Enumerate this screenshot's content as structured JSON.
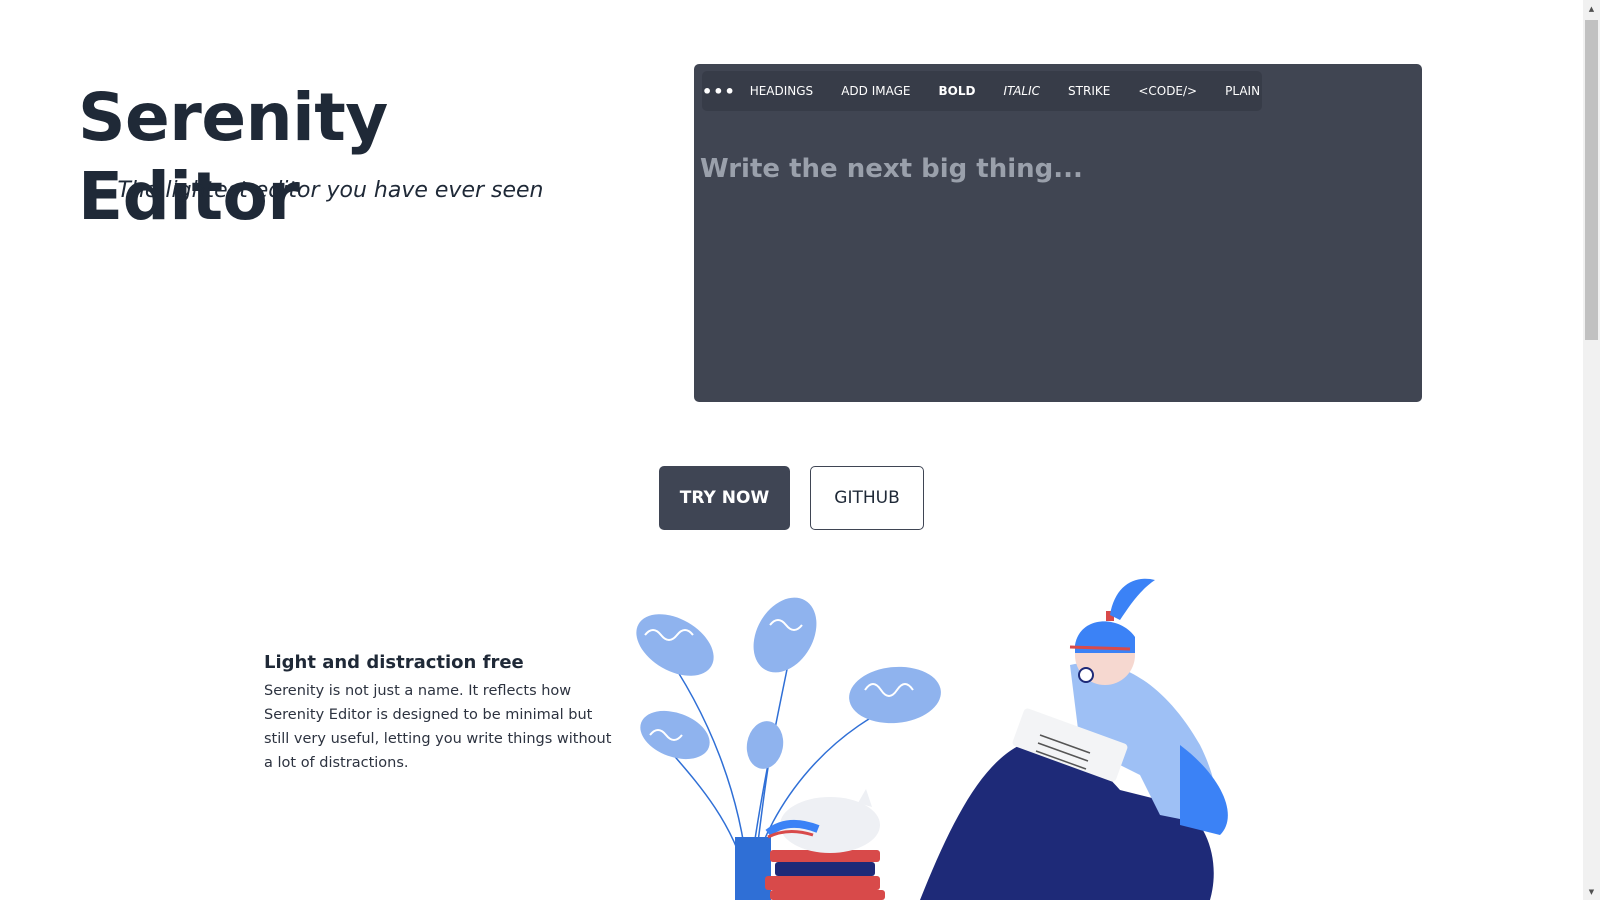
{
  "hero": {
    "title": "Serenity Editor",
    "subtitle": "The lightest editor you have ever seen"
  },
  "editor": {
    "menu_icon": "more-dots-icon",
    "toolbar": [
      "HEADINGS",
      "ADD IMAGE",
      "BOLD",
      "ITALIC",
      "STRIKE",
      "<CODE/>",
      "PLAIN"
    ],
    "placeholder": "Write the next big thing..."
  },
  "buttons": {
    "try_now": "TRY NOW",
    "github": "GITHUB"
  },
  "feature": {
    "title": "Light and distraction free",
    "text": "Serenity is not just a name. It reflects how Serenity Editor is designed to be minimal but still very useful, letting you write things without a lot of distractions."
  },
  "colors": {
    "editor_bg": "#404552",
    "toolbar_bg": "#373c48",
    "primary_button": "#3f4554",
    "title_text": "#1f2937",
    "illustration_blue": "#3b82f6",
    "illustration_navy": "#1e2a78"
  }
}
